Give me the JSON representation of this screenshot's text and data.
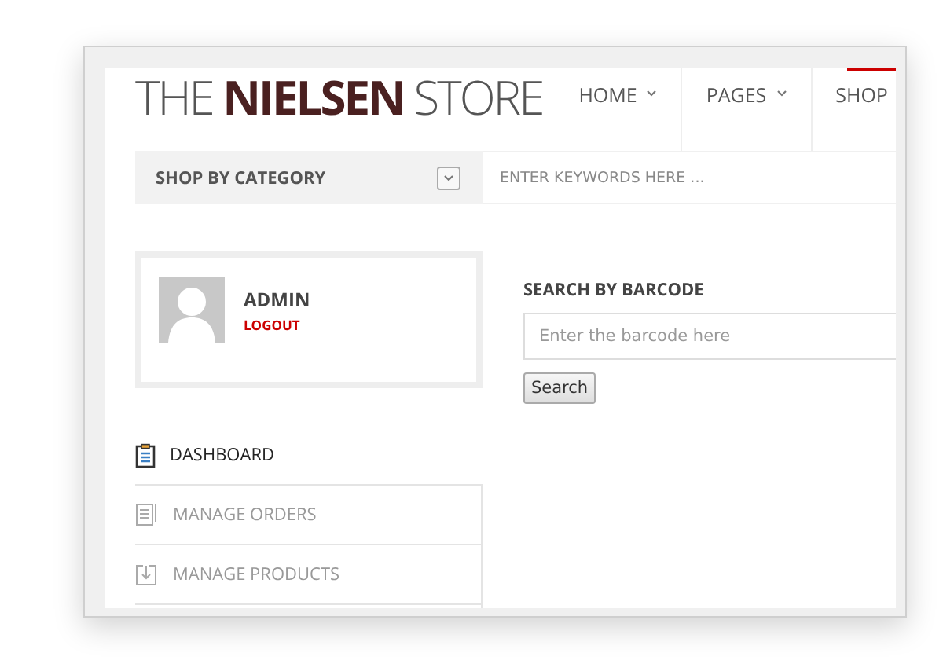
{
  "logo": "THE **NIELSEN** STORE",
  "nav": [
    {
      "label": "HOME",
      "has_caret": true,
      "selected": false
    },
    {
      "label": "PAGES",
      "has_caret": true,
      "selected": false
    },
    {
      "label": "SHOP",
      "has_caret": false,
      "selected": true
    }
  ],
  "category_bar": {
    "label": "SHOP BY CATEGORY",
    "search_placeholder": "ENTER KEYWORDS HERE ..."
  },
  "profile": {
    "name": "ADMIN",
    "logout": "LOGOUT"
  },
  "menu": [
    {
      "label": "DASHBOARD",
      "kind": "clipboard",
      "selected": true
    },
    {
      "label": "MANAGE ORDERS",
      "kind": "document",
      "selected": false
    },
    {
      "label": "MANAGE PRODUCTS",
      "kind": "download",
      "selected": false
    }
  ],
  "barcode": {
    "title": "SEARCH BY BARCODE",
    "placeholder": "Enter the barcode here",
    "button": "Search"
  }
}
